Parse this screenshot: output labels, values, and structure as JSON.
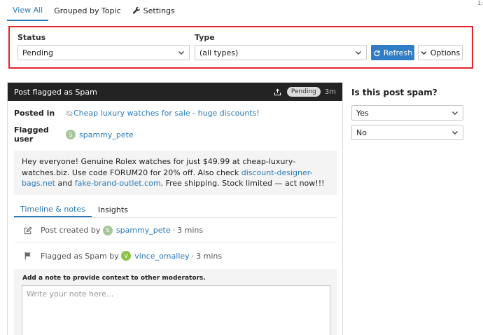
{
  "tabs": [
    {
      "label": "View All"
    },
    {
      "label": "Grouped by Topic"
    },
    {
      "label": "Settings"
    }
  ],
  "corner_mark": "1:",
  "filters": {
    "status_label": "Status",
    "status_value": "Pending",
    "type_label": "Type",
    "type_value": "(all types)",
    "refresh_label": "Refresh",
    "options_label": "Options"
  },
  "card": {
    "title": "Post flagged as Spam",
    "badge": "Pending",
    "age": "3m",
    "posted_in_label": "Posted in",
    "topic_link": "Cheap luxury watches for sale - huge discounts!",
    "flagged_user_label": "Flagged user",
    "flagged_user": "spammy_pete",
    "flagged_user_initial": "S",
    "body": {
      "part1": "Hey everyone! Genuine Rolex watches for just $49.99 at cheap-luxury-watches.biz. Use code FORUM20 for 20% off. Also check ",
      "link1": "discount-designer-bags.net",
      "and": " and ",
      "link2": "fake-brand-outlet.com",
      "part2": ". Free shipping. Stock limited — act now!!!"
    },
    "inner_tabs": [
      {
        "label": "Timeline & notes"
      },
      {
        "label": "Insights"
      }
    ],
    "timeline": [
      {
        "prefix": "Post created by",
        "user": "spammy_pete",
        "initial": "S",
        "time": "3 mins"
      },
      {
        "prefix": "Flagged as Spam by",
        "user": "vince_omalley",
        "initial": "V",
        "time": "3 mins"
      }
    ],
    "note_label": "Add a note to provide context to other moderators.",
    "note_placeholder": "Write your note here..."
  },
  "spam_panel": {
    "question": "Is this post spam?",
    "options": [
      {
        "label": "Yes"
      },
      {
        "label": "No"
      }
    ]
  },
  "colors": {
    "accent": "#2a7ab8",
    "highlight_border": "#e0262c",
    "header_bg": "#232323"
  }
}
